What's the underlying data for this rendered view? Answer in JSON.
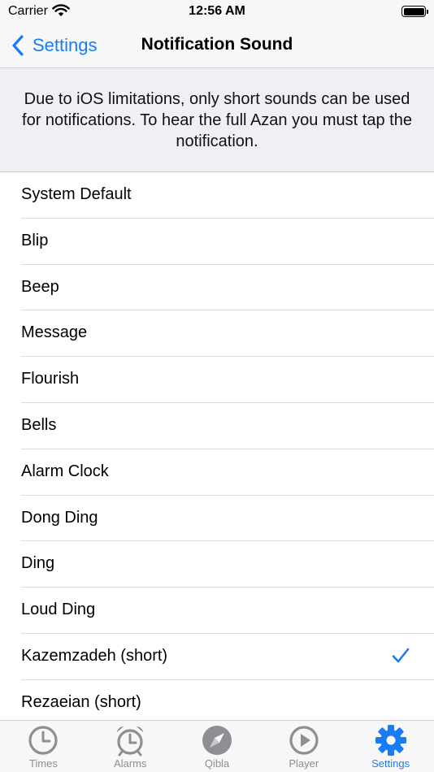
{
  "status_bar": {
    "carrier": "Carrier",
    "time": "12:56 AM"
  },
  "nav": {
    "back_label": "Settings",
    "title": "Notification Sound"
  },
  "notice": "Due to iOS limitations, only short sounds can be used for notifications. To hear the full Azan you must tap the notification.",
  "sounds": [
    {
      "label": "System Default",
      "selected": false
    },
    {
      "label": "Blip",
      "selected": false
    },
    {
      "label": "Beep",
      "selected": false
    },
    {
      "label": "Message",
      "selected": false
    },
    {
      "label": "Flourish",
      "selected": false
    },
    {
      "label": "Bells",
      "selected": false
    },
    {
      "label": "Alarm Clock",
      "selected": false
    },
    {
      "label": "Dong Ding",
      "selected": false
    },
    {
      "label": "Ding",
      "selected": false
    },
    {
      "label": "Loud Ding",
      "selected": false
    },
    {
      "label": "Kazemzadeh (short)",
      "selected": true
    },
    {
      "label": "Rezaeian (short)",
      "selected": false
    }
  ],
  "tabs": [
    {
      "label": "Times",
      "icon": "clock-icon",
      "active": false
    },
    {
      "label": "Alarms",
      "icon": "alarm-clock-icon",
      "active": false
    },
    {
      "label": "Qibla",
      "icon": "compass-icon",
      "active": false
    },
    {
      "label": "Player",
      "icon": "play-icon",
      "active": false
    },
    {
      "label": "Settings",
      "icon": "gear-icon",
      "active": true
    }
  ],
  "colors": {
    "accent": "#1a7cf5",
    "inactive_tab": "#8e8e93"
  }
}
